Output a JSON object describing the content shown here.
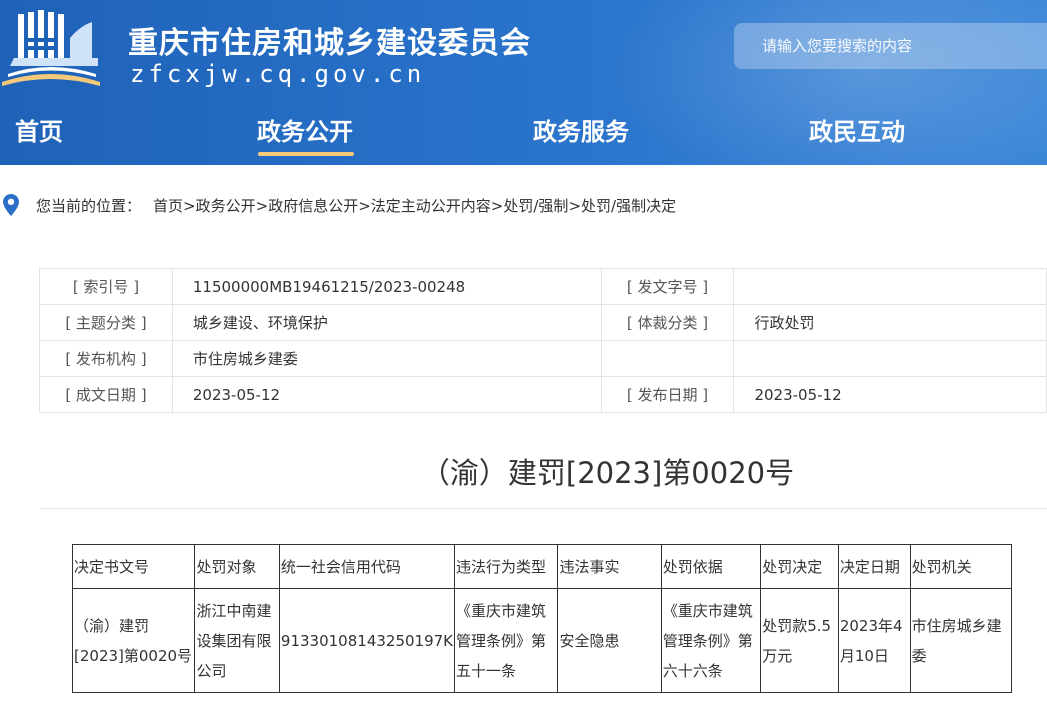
{
  "header": {
    "site_title": "重庆市住房和城乡建设委员会",
    "site_domain": "zfcxjw.cq.gov.cn",
    "search_placeholder": "请输入您要搜索的内容",
    "brand_color": "#2a6ec6",
    "accent_color": "#f5c97a"
  },
  "nav": {
    "items": [
      {
        "label": "首页"
      },
      {
        "label": "政务公开",
        "active": true
      },
      {
        "label": "政务服务"
      },
      {
        "label": "政民互动"
      }
    ]
  },
  "breadcrumb": {
    "icon": "location-pin-icon",
    "label": "您当前的位置：",
    "items": [
      "首页",
      "政务公开",
      "政府信息公开",
      "法定主动公开内容",
      "处罚/强制",
      "处罚/强制决定"
    ],
    "separator": ">"
  },
  "info": {
    "index_key": "[ 索引号 ]",
    "index_value": "11500000MB19461215/2023-00248",
    "docno_key": "[ 发文字号 ]",
    "docno_value": "",
    "topic_key": "[ 主题分类 ]",
    "topic_value": "城乡建设、环境保护",
    "genre_key": "[ 体裁分类 ]",
    "genre_value": "行政处罚",
    "org_key": "[ 发布机构 ]",
    "org_value": "市住房城乡建委",
    "created_key": "[ 成文日期 ]",
    "created_value": "2023-05-12",
    "published_key": "[ 发布日期 ]",
    "published_value": "2023-05-12"
  },
  "document": {
    "title": "（渝）建罚[2023]第0020号"
  },
  "decision_table": {
    "headers": [
      "决定书文号",
      "处罚对象",
      "统一社会信用代码",
      "违法行为类型",
      "违法事实",
      "处罚依据",
      "处罚决定",
      "决定日期",
      "处罚机关"
    ],
    "row": [
      "（渝）建罚[2023]第0020号",
      "浙江中南建设集团有限公司",
      "91330108143250197K",
      "《重庆市建筑管理条例》第五十一条",
      "安全隐患",
      "《重庆市建筑管理条例》第六十六条",
      "处罚款5.5万元",
      "2023年4月10日",
      "市住房城乡建委"
    ]
  }
}
